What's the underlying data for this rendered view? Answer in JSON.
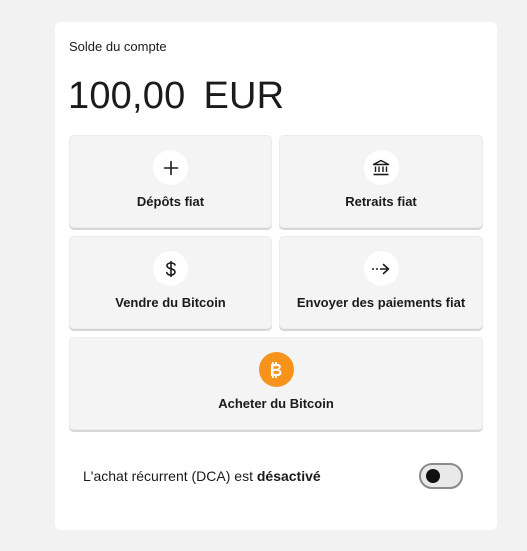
{
  "account": {
    "balance_label": "Solde du compte",
    "balance_amount": "100,00",
    "balance_currency": "EUR"
  },
  "actions": {
    "deposit": {
      "label": "Dépôts fiat",
      "icon": "plus-icon"
    },
    "withdraw": {
      "label": "Retraits fiat",
      "icon": "bank-icon"
    },
    "sell": {
      "label": "Vendre du Bitcoin",
      "icon": "dollar-icon"
    },
    "send": {
      "label": "Envoyer des paiements fiat",
      "icon": "dashed-arrow-right-icon"
    },
    "buy": {
      "label": "Acheter du Bitcoin",
      "icon": "bitcoin-icon"
    }
  },
  "dca": {
    "text": "L'achat récurrent (DCA) est",
    "status": "désactivé",
    "enabled": false
  },
  "colors": {
    "bitcoin_orange": "#f7931a",
    "tile_background": "#f4f4f4",
    "page_background": "#f2f2f2"
  }
}
